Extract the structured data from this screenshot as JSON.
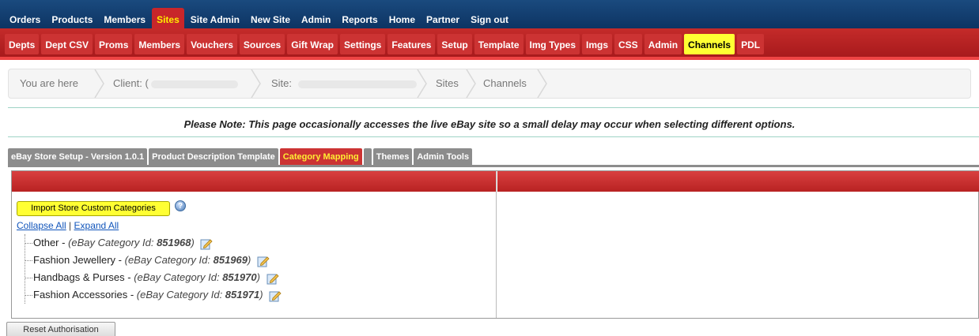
{
  "topnav": {
    "items": [
      {
        "label": "Orders",
        "active": false
      },
      {
        "label": "Products",
        "active": false
      },
      {
        "label": "Members",
        "active": false
      },
      {
        "label": "Sites",
        "active": true
      },
      {
        "label": "Site Admin",
        "active": false
      },
      {
        "label": "New Site",
        "active": false
      },
      {
        "label": "Admin",
        "active": false
      },
      {
        "label": "Reports",
        "active": false
      },
      {
        "label": "Home",
        "active": false
      },
      {
        "label": "Partner",
        "active": false
      },
      {
        "label": "Sign out",
        "active": false
      }
    ]
  },
  "subnav": {
    "items": [
      {
        "label": "Depts",
        "active": false
      },
      {
        "label": "Dept CSV",
        "active": false
      },
      {
        "label": "Proms",
        "active": false
      },
      {
        "label": "Members",
        "active": false
      },
      {
        "label": "Vouchers",
        "active": false
      },
      {
        "label": "Sources",
        "active": false
      },
      {
        "label": "Gift Wrap",
        "active": false
      },
      {
        "label": "Settings",
        "active": false
      },
      {
        "label": "Features",
        "active": false
      },
      {
        "label": "Setup",
        "active": false
      },
      {
        "label": "Template",
        "active": false
      },
      {
        "label": "Img Types",
        "active": false
      },
      {
        "label": "Imgs",
        "active": false
      },
      {
        "label": "CSS",
        "active": false
      },
      {
        "label": "Admin",
        "active": false
      },
      {
        "label": "Channels",
        "active": true
      },
      {
        "label": "PDL",
        "active": false
      }
    ]
  },
  "breadcrumb": {
    "you_are_here": "You are here",
    "client_label": "Client:",
    "client_prefix": "(",
    "site_label": "Site:",
    "sites": "Sites",
    "channels": "Channels"
  },
  "note": "Please Note: This page occasionally accesses the live eBay site so a small delay may occur when selecting different options.",
  "tabs": [
    {
      "label": "eBay Store Setup - Version 1.0.1",
      "active": false
    },
    {
      "label": "Product Description Template",
      "active": false
    },
    {
      "label": "Category Mapping",
      "active": true
    },
    {
      "label": "",
      "active": false
    },
    {
      "label": "Themes",
      "active": false
    },
    {
      "label": "Admin Tools",
      "active": false
    }
  ],
  "panel": {
    "import_button": "Import Store Custom Categories",
    "help_icon": "?",
    "collapse_all": "Collapse All",
    "link_separator": "|",
    "expand_all": "Expand All",
    "tree": [
      {
        "name": "Other",
        "sep": " - ",
        "meta_prefix": "(eBay Category Id: ",
        "id": "851968",
        "meta_suffix": ")"
      },
      {
        "name": "Fashion Jewellery",
        "sep": " - ",
        "meta_prefix": "(eBay Category Id: ",
        "id": "851969",
        "meta_suffix": ")"
      },
      {
        "name": "Handbags & Purses",
        "sep": " - ",
        "meta_prefix": "(eBay Category Id: ",
        "id": "851970",
        "meta_suffix": ")"
      },
      {
        "name": "Fashion Accessories",
        "sep": " - ",
        "meta_prefix": "(eBay Category Id: ",
        "id": "851971",
        "meta_suffix": ")"
      }
    ]
  },
  "reset_button": "Reset Authorisation",
  "colors": {
    "topnav_bg": "#0d3463",
    "subnav_bg": "#b82222",
    "active_highlight": "#ffff33",
    "link": "#1155bb"
  }
}
